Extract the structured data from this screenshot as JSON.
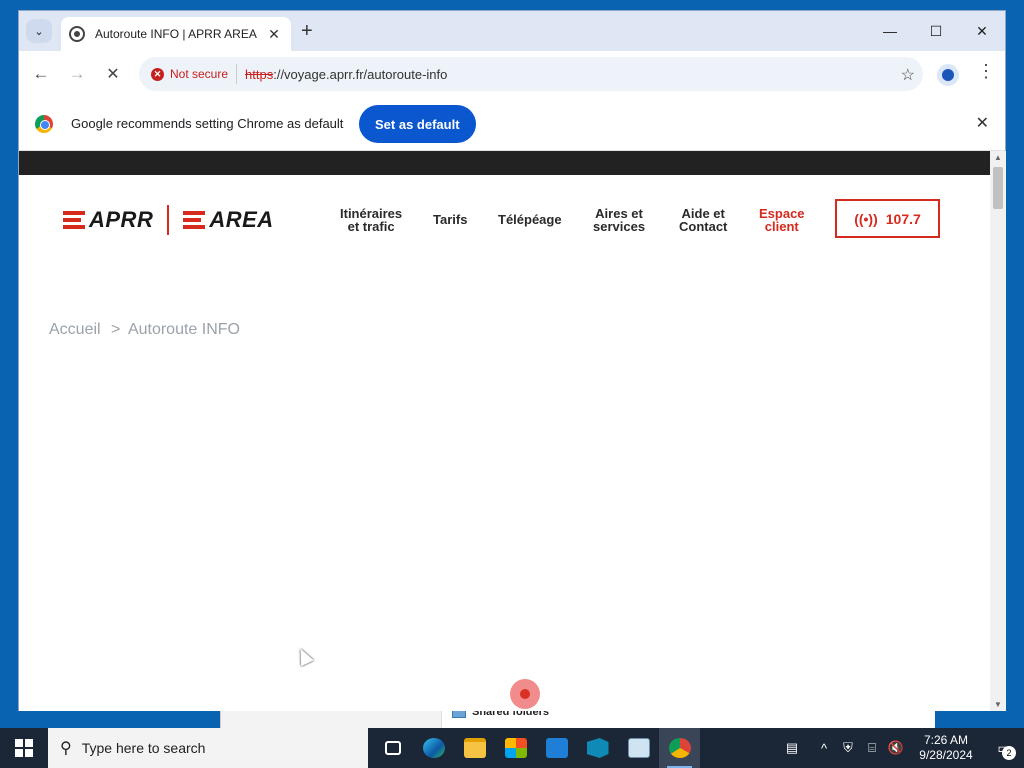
{
  "browser": {
    "tab_title": "Autoroute INFO | APRR AREA",
    "tab_close": "✕",
    "new_tab": "+",
    "tab_search": "⌄",
    "window_controls": {
      "minimize": "—",
      "maximize": "☐",
      "close": "✕"
    },
    "nav": {
      "back": "←",
      "forward": "→",
      "stop": "✕"
    },
    "security_label": "Not secure",
    "url_scheme": "https",
    "url_rest": "://voyage.aprr.fr/autoroute-info",
    "bookmark": "☆",
    "menu": "⋮"
  },
  "infobar": {
    "message": "Google recommends setting Chrome as default",
    "button": "Set as default",
    "close": "✕"
  },
  "site": {
    "logo_left": "APRR",
    "logo_right": "AREA",
    "nav": [
      {
        "line1": "Itinéraires",
        "line2": "et trafic"
      },
      {
        "line1": "Tarifs",
        "line2": ""
      },
      {
        "line1": "Télépéage",
        "line2": ""
      },
      {
        "line1": "Aires et",
        "line2": "services"
      },
      {
        "line1": "Aide et",
        "line2": "Contact"
      },
      {
        "line1": "Espace",
        "line2": "client"
      }
    ],
    "radio_icon": "((•))",
    "radio_label": "107.7",
    "breadcrumb": {
      "home": "Accueil",
      "separator": ">",
      "current": "Autoroute INFO"
    }
  },
  "background_window": {
    "item": "Shared folders"
  },
  "taskbar": {
    "search_placeholder": "Type here to search",
    "search_icon": "search-icon",
    "time": "7:26 AM",
    "date": "9/28/2024",
    "notifications_count": "2",
    "tray": {
      "chevron": "^"
    }
  },
  "colors": {
    "brand_red": "#d52b1e",
    "chrome_blue": "#0b57d0",
    "breadcrumb_grey": "#9aa3ab"
  }
}
